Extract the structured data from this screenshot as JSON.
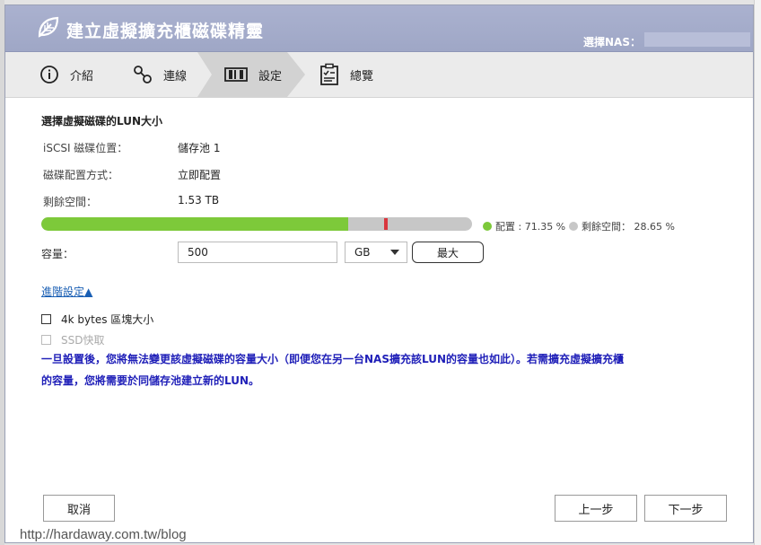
{
  "window": {
    "title": "建立虛擬擴充櫃磁碟精靈",
    "nas_label": "選擇NAS："
  },
  "steps": [
    {
      "label": "介紹",
      "icon": "info-icon"
    },
    {
      "label": "連線",
      "icon": "link-icon"
    },
    {
      "label": "設定",
      "icon": "disk-settings-icon",
      "active": true
    },
    {
      "label": "總覽",
      "icon": "clipboard-icon"
    }
  ],
  "section": {
    "title": "選擇虛擬磁碟的LUN大小",
    "rows": [
      {
        "label": "iSCSI 磁碟位置：",
        "value": "儲存池 1"
      },
      {
        "label": "磁碟配置方式：",
        "value": "立即配置"
      },
      {
        "label": "剩餘空間：",
        "value": "1.53 TB"
      }
    ]
  },
  "usage": {
    "allocated_fraction": 0.7135,
    "marker_fraction": 0.8,
    "allocated_legend": "配置 : 71.35 %",
    "free_legend": "剩餘空間：  28.65 %",
    "allocated_color": "#7dc93a",
    "free_color": "#c7c7c7",
    "marker_color": "#d9363e"
  },
  "capacity": {
    "label": "容量：",
    "value": "500",
    "unit": "GB",
    "max_label": "最大"
  },
  "advanced": {
    "link_label": "進階設定▲",
    "options": [
      {
        "label": "4k bytes 區塊大小",
        "checked": false,
        "disabled": false
      },
      {
        "label": "SSD快取",
        "checked": false,
        "disabled": true
      }
    ]
  },
  "warning": {
    "line1": "一旦設置後，您將無法變更該虛擬磁碟的容量大小（即便您在另一台NAS擴充該LUN的容量也如此）。若需擴充虛擬擴充櫃",
    "line2": "的容量，您將需要於同儲存池建立新的LUN。",
    "color": "#1f1fb8"
  },
  "buttons": {
    "cancel": "取消",
    "prev": "上一步",
    "next": "下一步"
  },
  "watermark": "http://hardaway.com.tw/blog"
}
